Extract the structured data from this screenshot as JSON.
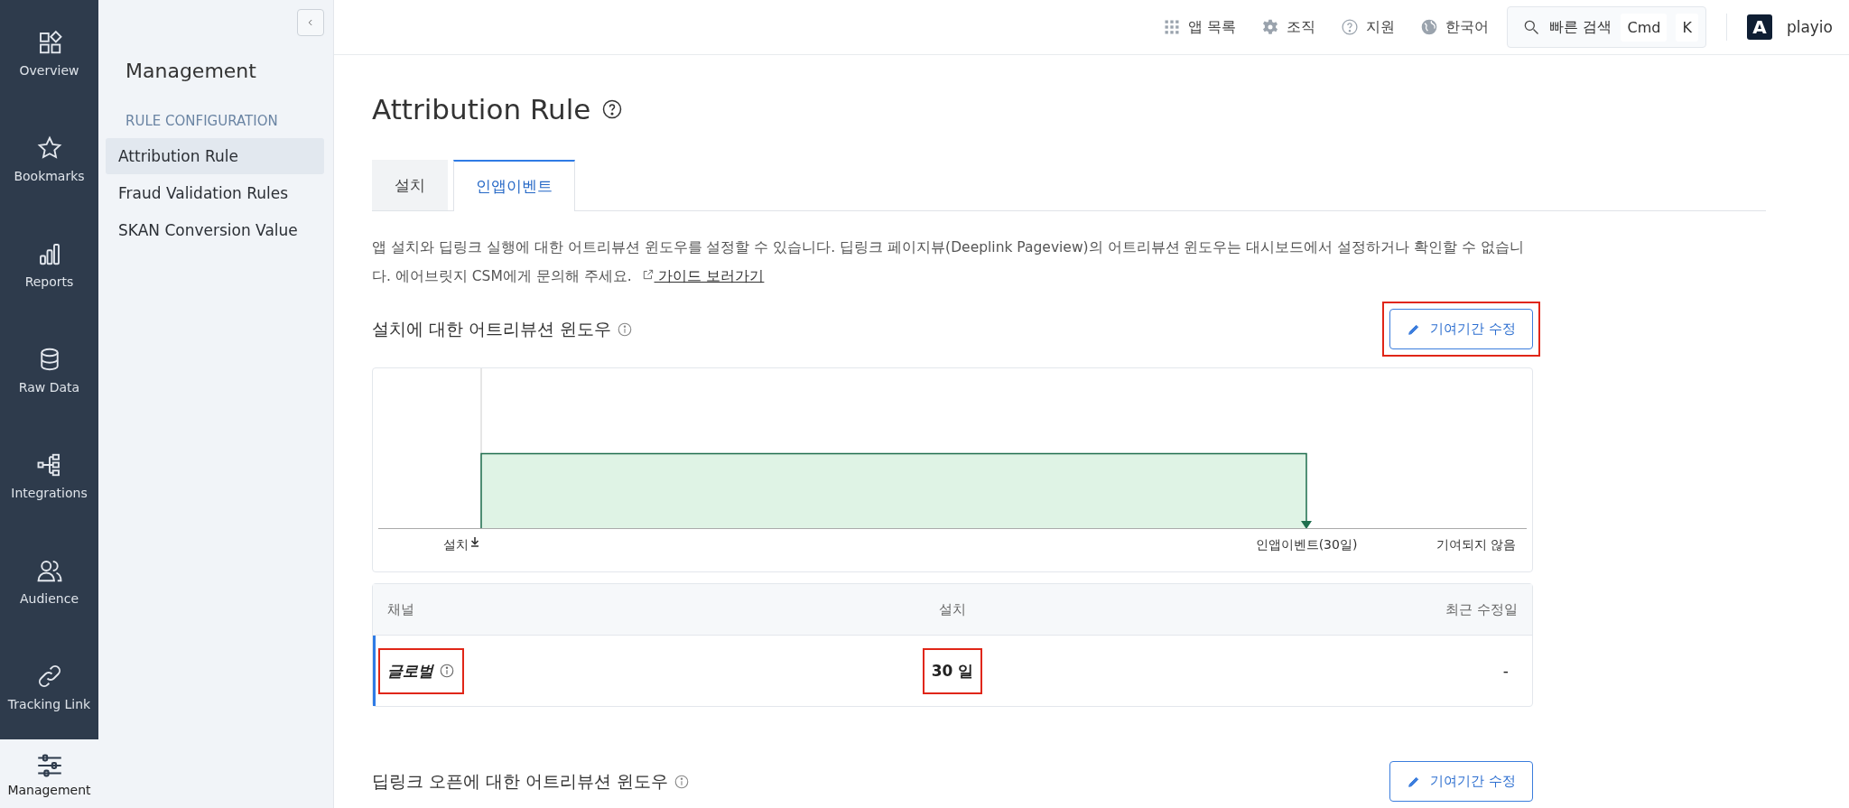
{
  "rail": {
    "items": [
      {
        "label": "Overview",
        "selected": false
      },
      {
        "label": "Bookmarks",
        "selected": false
      },
      {
        "label": "Reports",
        "selected": false
      },
      {
        "label": "Raw Data",
        "selected": false
      },
      {
        "label": "Integrations",
        "selected": false
      },
      {
        "label": "Audience",
        "selected": false
      },
      {
        "label": "Tracking Link",
        "selected": false
      },
      {
        "label": "Management",
        "selected": true
      }
    ]
  },
  "subnav": {
    "title": "Management",
    "section": "RULE CONFIGURATION",
    "items": [
      {
        "label": "Attribution Rule",
        "selected": true
      },
      {
        "label": "Fraud Validation Rules",
        "selected": false
      },
      {
        "label": "SKAN Conversion Value",
        "selected": false
      }
    ]
  },
  "topbar": {
    "items": [
      "앱 목록",
      "조직",
      "지원",
      "한국어"
    ],
    "search": {
      "label": "빠른 검색",
      "keys": [
        "Cmd",
        "K"
      ]
    },
    "account": {
      "initial": "A",
      "name": "playio"
    }
  },
  "page": {
    "title": "Attribution Rule",
    "tabs": [
      {
        "label": "설치",
        "selected": false
      },
      {
        "label": "인앱이벤트",
        "selected": true
      }
    ],
    "description": "앱 설치와 딥링크 실행에 대한 어트리뷰션 윈도우를 설정할 수 있습니다. 딥링크 페이지뷰(Deeplink Pageview)의 어트리뷰션 윈도우는 대시보드에서 설정하거나 확인할 수 없습니다. 에어브릿지 CSM에게 문의해 주세요.",
    "link": "가이드 보러가기"
  },
  "sections": [
    {
      "title": "설치에 대한 어트리뷰션 윈도우",
      "button": {
        "label": "기여기간 수정",
        "highlighted": true
      },
      "chart_labels": [
        "설치",
        "인앱이벤트(30일)",
        "기여되지 않음"
      ],
      "table": {
        "columns": [
          "채널",
          "설치",
          "최근 수정일"
        ],
        "rows": [
          {
            "selected": true,
            "cells": [
              {
                "text": "글로벌",
                "highlighted": true
              },
              {
                "text": "30 일",
                "highlighted": true
              },
              {
                "text": "-",
                "highlighted": false
              }
            ]
          }
        ]
      }
    },
    {
      "title": "딥링크 오픈에 대한 어트리뷰션 윈도우",
      "button": {
        "label": "기여기간 수정",
        "highlighted": false
      }
    }
  ]
}
